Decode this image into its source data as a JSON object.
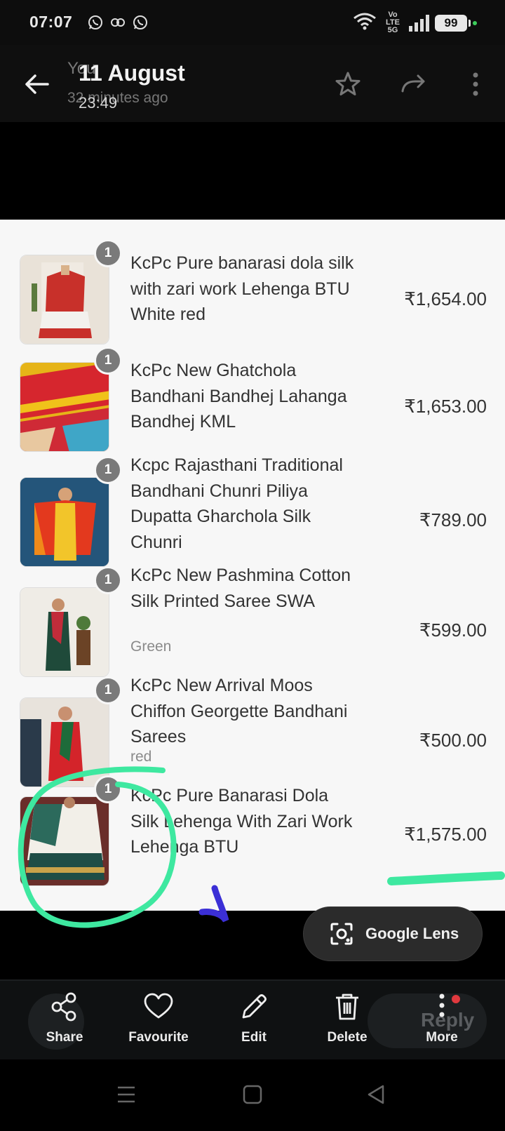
{
  "status_bar": {
    "time": "07:07",
    "network": "Vo LTE 5G",
    "battery": "99"
  },
  "header": {
    "ghost_title": "You",
    "ghost_subtitle": "32 minutes ago",
    "date": "11 August",
    "time": "23:49"
  },
  "order": {
    "items": [
      {
        "name": "KcPc Pure banarasi dola silk with zari work Lehenga BTU White red",
        "variant": "",
        "qty": "1",
        "price": "₹1,654.00"
      },
      {
        "name": "KcPc New Ghatchola Bandhani Bandhej Lahanga Bandhej KML",
        "variant": "",
        "qty": "1",
        "price": "₹1,653.00"
      },
      {
        "name": "Kcpc Rajasthani Traditional Bandhani Chunri Piliya Dupatta Gharchola Silk Chunri",
        "variant": "",
        "qty": "1",
        "price": "₹789.00"
      },
      {
        "name": "KcPc New Pashmina Cotton Silk Printed Saree SWA",
        "variant": "Green",
        "qty": "1",
        "price": "₹599.00"
      },
      {
        "name": "KcPc New Arrival Moos Chiffon Georgette Bandhani Sarees",
        "variant": "red",
        "qty": "1",
        "price": "₹500.00"
      },
      {
        "name": "KcPc Pure Banarasi Dola Silk Lehenga With Zari Work Lehenga BTU",
        "variant": "",
        "qty": "1",
        "price": "₹1,575.00"
      }
    ]
  },
  "lens": {
    "label": "Google Lens"
  },
  "toolbar": {
    "share": "Share",
    "favourite": "Favourite",
    "edit": "Edit",
    "delete": "Delete",
    "more": "More",
    "ghost_reply": "Reply"
  },
  "colors": {
    "annotation_green": "#3ee8a0",
    "annotation_blue": "#3b2fd6",
    "badge_grey": "#7a7a7a"
  }
}
